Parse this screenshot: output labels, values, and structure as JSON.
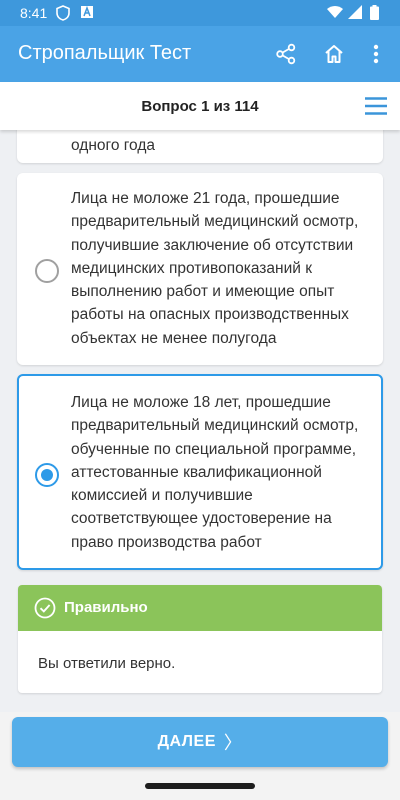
{
  "status_bar": {
    "time": "8:41",
    "icons": [
      "shield-icon",
      "font-icon",
      "wifi-icon",
      "signal-icon",
      "battery-icon"
    ]
  },
  "app_bar": {
    "title": "Стропальщик Тест",
    "actions": [
      "share-icon",
      "home-icon",
      "more-vert-icon"
    ],
    "color": "#4aa3e6"
  },
  "question": {
    "counter": "Вопрос 1 из 114"
  },
  "options": [
    {
      "text": "одного года",
      "selected": false,
      "partially_visible": true
    },
    {
      "text": "Лица не моложе 21 года, прошедшие предварительный медицинский осмотр, получившие заключение об отсутствии медицинских противопоказаний к выполнению работ и имеющие опыт работы на опасных производственных объектах не менее полугода",
      "selected": false
    },
    {
      "text": "Лица не моложе 18 лет, прошедшие предварительный медицинский осмотр, обученные по специальной программе, аттестованные квалификационной комиссией и получившие соответствующее удостоверение на право производства работ",
      "selected": true
    }
  ],
  "result": {
    "title": "Правильно",
    "message": "Вы ответили верно.",
    "color": "#8bc45a"
  },
  "footer": {
    "next_label": "ДАЛЕЕ",
    "next_chevron": "〉"
  }
}
